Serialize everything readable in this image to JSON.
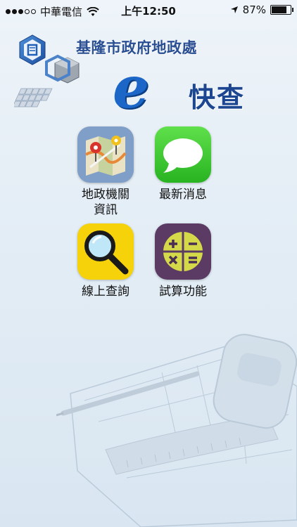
{
  "status_bar": {
    "carrier": "中華電信",
    "time": "上午12:50",
    "battery_percent": "87%",
    "battery_level": 0.87
  },
  "header": {
    "office_name": "基隆市政府地政處",
    "e_letter": "e",
    "app_name": "快查"
  },
  "menu": [
    {
      "label": "地政機關\n資訊",
      "icon": "map-pin-icon"
    },
    {
      "label": "最新消息",
      "icon": "speech-bubble-icon"
    },
    {
      "label": "線上查詢",
      "icon": "magnifier-icon"
    },
    {
      "label": "試算功能",
      "icon": "calculator-icon"
    }
  ],
  "colors": {
    "office_name": "#2a4f93",
    "e_letter": "#1b66c7",
    "app_name": "#1d4691",
    "news_green": "#3fcf3a",
    "search_yellow": "#f6d20b",
    "calc_purple": "#5b3a63",
    "calc_yellow": "#d4d94a",
    "map_blue": "#7f9ec8"
  }
}
